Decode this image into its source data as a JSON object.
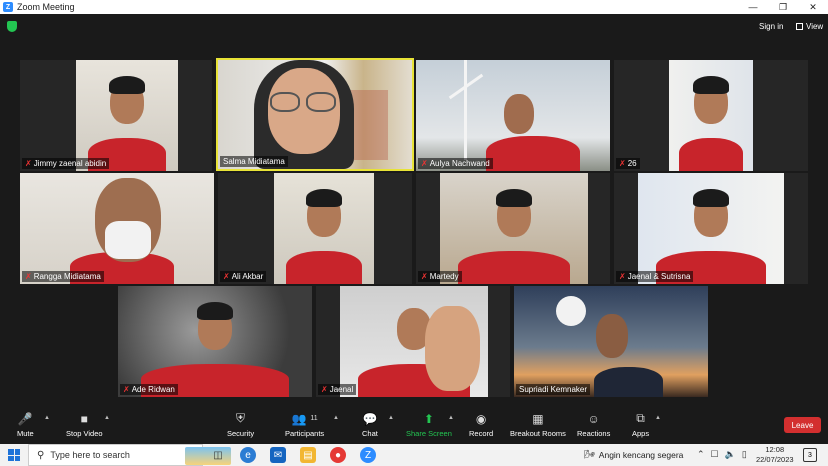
{
  "window": {
    "title": "Zoom Meeting",
    "icon": "zoom-logo"
  },
  "top_bar": {
    "sign_in": "Sign in",
    "view": "View"
  },
  "participants": [
    {
      "name": "Jimmy zaenal abidin",
      "muted": true
    },
    {
      "name": "Salma Midiatama",
      "muted": false,
      "active_speaker": true
    },
    {
      "name": "Aulya Nachwand",
      "muted": true
    },
    {
      "name": "26",
      "muted": true
    },
    {
      "name": "Rangga Midiatama",
      "muted": true
    },
    {
      "name": "Ali Akbar",
      "muted": true
    },
    {
      "name": "Martedy",
      "muted": true
    },
    {
      "name": "Jaenal & Sutrisna",
      "muted": true
    },
    {
      "name": "Ade Ridwan",
      "muted": true
    },
    {
      "name": "Jaenal",
      "muted": true
    },
    {
      "name": "Supriadi Kemnaker",
      "muted": false
    }
  ],
  "toolbar": {
    "mute": "Mute",
    "stop_video": "Stop Video",
    "security": "Security",
    "participants": "Participants",
    "participants_count": "11",
    "chat": "Chat",
    "share_screen": "Share Screen",
    "record": "Record",
    "breakout_rooms": "Breakout Rooms",
    "reactions": "Reactions",
    "apps": "Apps",
    "leave": "Leave"
  },
  "taskbar": {
    "search_placeholder": "Type here to search",
    "weather": "Angin kencang segera",
    "time": "12:08",
    "date": "22/07/2023",
    "notification_count": "3"
  },
  "colors": {
    "active_speaker_border": "#e8e337",
    "leave": "#d32f2f",
    "share_screen": "#23c552"
  }
}
